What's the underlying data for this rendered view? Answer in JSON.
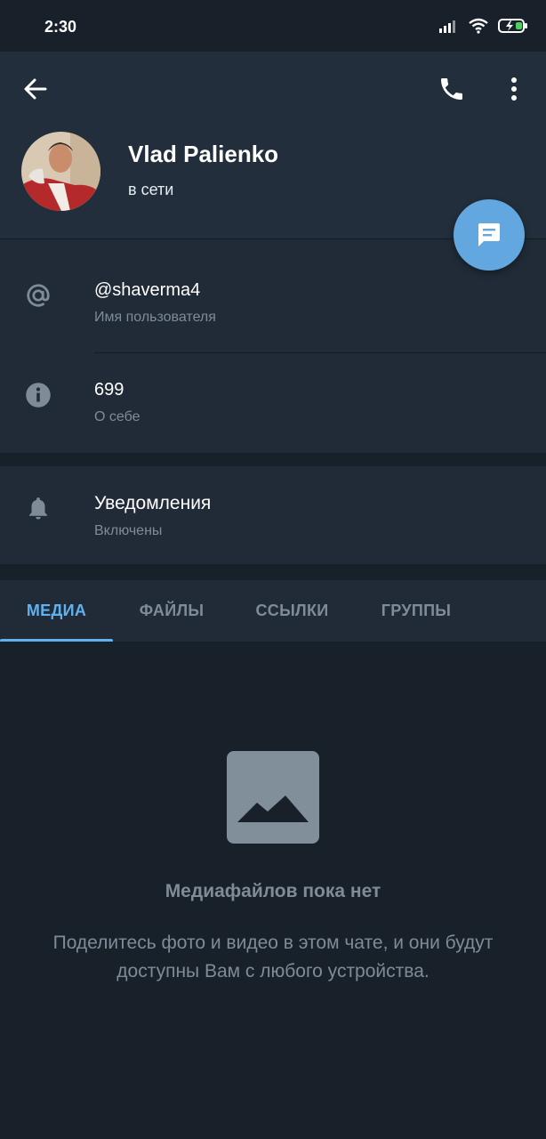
{
  "status_bar": {
    "time": "2:30",
    "icons": [
      "signal-icon",
      "wifi-icon",
      "battery-charging-icon"
    ]
  },
  "toolbar": {
    "back_icon": "arrow-left-icon",
    "call_icon": "phone-icon",
    "more_icon": "more-vertical-icon"
  },
  "profile": {
    "name": "Vlad Palienko",
    "status": "в сети"
  },
  "fab": {
    "icon": "message-icon",
    "color": "#62a7e0"
  },
  "info": {
    "username": {
      "value": "@shaverma4",
      "label": "Имя пользователя",
      "icon": "at-icon"
    },
    "bio": {
      "value": "699",
      "label": "О себе",
      "icon": "info-icon"
    }
  },
  "notifications": {
    "title": "Уведомления",
    "value": "Включены",
    "icon": "bell-icon"
  },
  "tabs": [
    {
      "label": "МЕДИА",
      "active": true
    },
    {
      "label": "ФАЙЛЫ",
      "active": false
    },
    {
      "label": "ССЫЛКИ",
      "active": false
    },
    {
      "label": "ГРУППЫ",
      "active": false
    }
  ],
  "empty_state": {
    "icon": "image-placeholder-icon",
    "title": "Медиафайлов пока нет",
    "text": "Поделитесь фото и видео в этом чате, и они будут доступны Вам с любого устройства."
  },
  "colors": {
    "background": "#18202a",
    "header": "#222e3b",
    "card": "#202b37",
    "accent": "#5fb2ee",
    "muted_text": "#7f8b97"
  }
}
